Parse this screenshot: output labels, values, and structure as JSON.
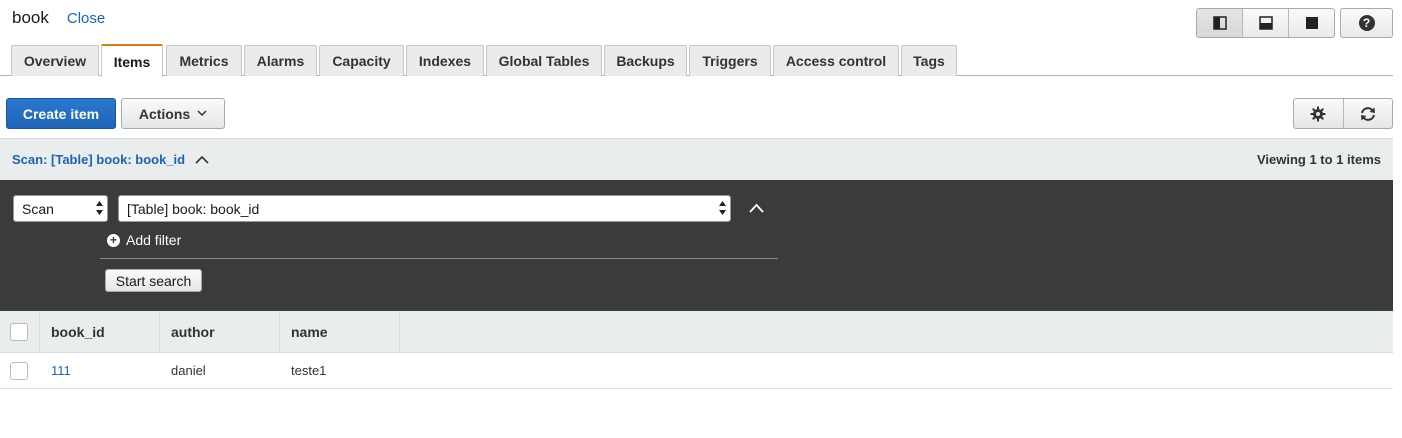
{
  "header": {
    "title": "book",
    "close_label": "Close"
  },
  "view_toggle": {
    "icons": [
      "split-vertical-icon",
      "split-horizontal-icon",
      "fullscreen-icon"
    ],
    "help_icon": "help-icon"
  },
  "tabs": [
    {
      "label": "Overview"
    },
    {
      "label": "Items",
      "active": true
    },
    {
      "label": "Metrics"
    },
    {
      "label": "Alarms"
    },
    {
      "label": "Capacity"
    },
    {
      "label": "Indexes"
    },
    {
      "label": "Global Tables"
    },
    {
      "label": "Backups"
    },
    {
      "label": "Triggers"
    },
    {
      "label": "Access control"
    },
    {
      "label": "Tags"
    }
  ],
  "toolbar": {
    "create_label": "Create item",
    "actions_label": "Actions"
  },
  "scan_bar": {
    "title": "Scan: [Table] book: book_id",
    "viewing": "Viewing 1 to 1 items"
  },
  "query_panel": {
    "mode_value": "Scan",
    "target_value": "[Table] book: book_id",
    "add_filter_label": "Add filter",
    "start_search_label": "Start search"
  },
  "table": {
    "columns": [
      "book_id",
      "author",
      "name"
    ],
    "rows": [
      [
        "111",
        "daniel",
        "teste1"
      ]
    ]
  },
  "colors": {
    "accent": "#1d63b3",
    "primary_button": "#1f65b8",
    "active_tab": "#e07b10",
    "panel": "#3b3b3b"
  }
}
